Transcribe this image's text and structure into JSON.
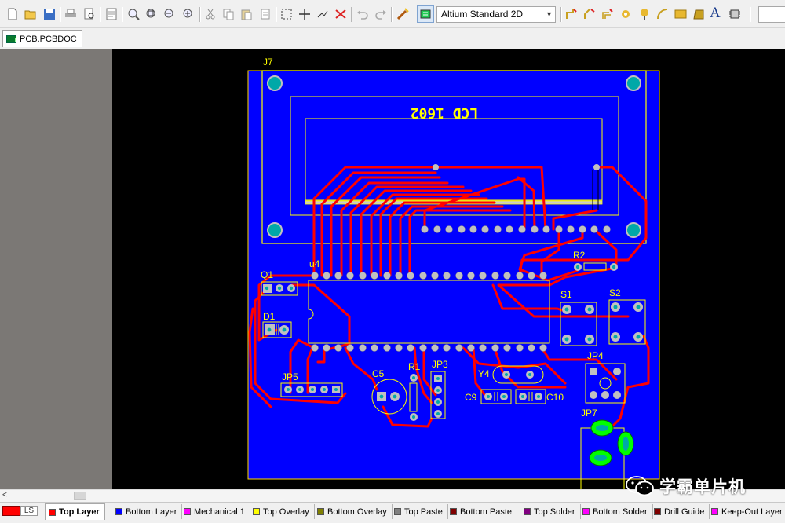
{
  "toolbar": {
    "view_mode": "Altium Standard 2D",
    "icons": [
      "new-icon",
      "open-icon",
      "save-icon",
      "print-icon",
      "print-preview-icon",
      "report-icon",
      "zoom-fit-icon",
      "zoom-area-icon",
      "zoom-selected-icon",
      "zoom-filter-icon",
      "cut-icon",
      "copy-icon",
      "paste-icon",
      "rubber-stamp-icon",
      "select-area-icon",
      "move-icon",
      "deselect-icon",
      "clear-filter-icon",
      "undo-icon",
      "redo-icon",
      "cross-probe-icon",
      "view-config-icon",
      "route-icon",
      "interactive-route-icon",
      "differential-route-icon",
      "place-via-icon",
      "place-pad-icon",
      "place-arc-icon",
      "place-fill-icon",
      "place-string-icon",
      "place-component-icon"
    ]
  },
  "document": {
    "tab_label": "PCB.PCBDOC"
  },
  "board": {
    "colors": {
      "board_fill": "#0000ff",
      "top_copper": "#ff0000",
      "overlay": "#ffff00",
      "pad": "#c0c0c0",
      "multilayer_hole": "#00a8a8",
      "jp7_pad": "#00ff00",
      "workspace_bg": "#000000",
      "gutter": "#7b7875"
    },
    "designators": {
      "j7": "J7",
      "lcd_title": "LCD  1602",
      "u4": "u4",
      "q1": "Q1",
      "d1": "D1",
      "r2": "R2",
      "s1": "S1",
      "s2": "S2",
      "jp5": "JP5",
      "c5": "C5",
      "r1": "R1",
      "jp3": "JP3",
      "y4": "Y4",
      "jp4": "JP4",
      "c9": "C9",
      "c10": "C10",
      "jp7": "JP7"
    }
  },
  "scrollbar": {
    "left_arrow": "<"
  },
  "layer_tabs": {
    "ls_button": "LS",
    "tabs": [
      {
        "name": "Top Layer",
        "color": "#ff0000",
        "active": true
      },
      {
        "name": "Bottom Layer",
        "color": "#0000ff",
        "active": false
      },
      {
        "name": "Mechanical 1",
        "color": "#ff00ff",
        "active": false
      },
      {
        "name": "Top Overlay",
        "color": "#ffff00",
        "active": false
      },
      {
        "name": "Bottom Overlay",
        "color": "#808000",
        "active": false
      },
      {
        "name": "Top Paste",
        "color": "#808080",
        "active": false
      },
      {
        "name": "Bottom Paste",
        "color": "#800000",
        "active": false
      },
      {
        "name": "Top Solder",
        "color": "#800080",
        "active": false
      },
      {
        "name": "Bottom Solder",
        "color": "#ff00ff",
        "active": false
      },
      {
        "name": "Drill Guide",
        "color": "#800000",
        "active": false
      },
      {
        "name": "Keep-Out Layer",
        "color": "#ff00ff",
        "active": false
      }
    ]
  },
  "watermark": {
    "text": "学霸单片机"
  }
}
